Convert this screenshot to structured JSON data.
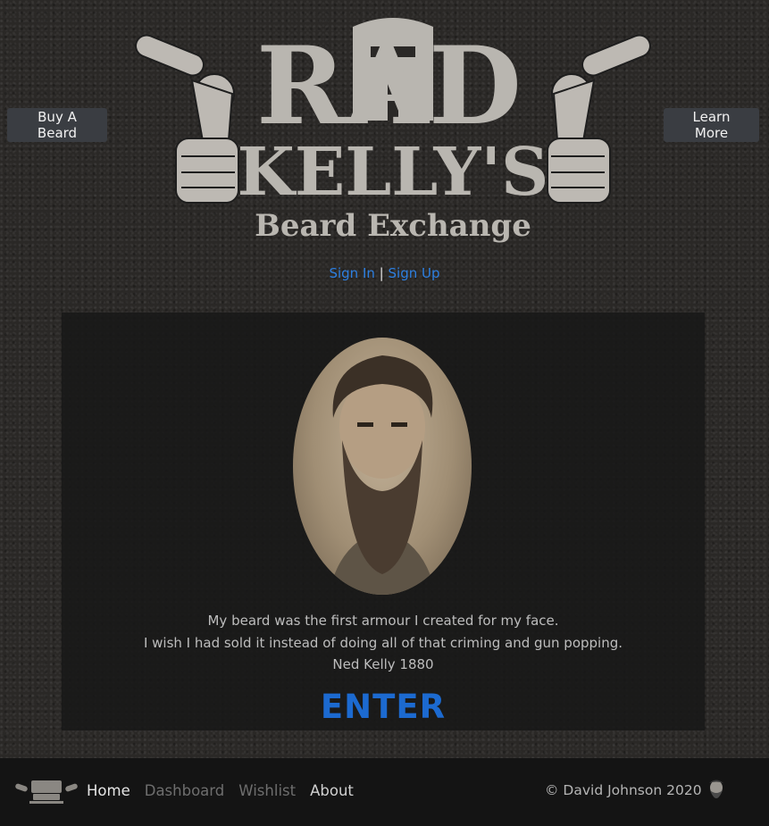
{
  "header": {
    "buy_button_label": "Buy A Beard",
    "learn_button_label": "Learn More",
    "logo_text": {
      "line1": "RAD",
      "line2": "KELLY'S",
      "line3": "Beard Exchange"
    }
  },
  "auth": {
    "sign_in_label": "Sign In",
    "separator": "|",
    "sign_up_label": "Sign Up"
  },
  "hero": {
    "quote_line1": "My beard was the first armour I created for my face.",
    "quote_line2": "I wish I had sold it instead of doing all of that criming and gun popping.",
    "attribution": "Ned Kelly 1880",
    "enter_label": "ENTER"
  },
  "footer": {
    "nav": [
      {
        "label": "Home"
      },
      {
        "label": "Dashboard"
      },
      {
        "label": "Wishlist"
      },
      {
        "label": "About"
      }
    ],
    "copyright": "© David Johnson 2020"
  },
  "colors": {
    "link_blue": "#2d7fe0",
    "enter_blue": "#1c6ad0",
    "logo_grey": "#b9b6b0",
    "footer_bg": "#141414"
  },
  "icons": [
    "revolver-icon",
    "ned-kelly-helmet-icon",
    "bearded-man-icon"
  ]
}
